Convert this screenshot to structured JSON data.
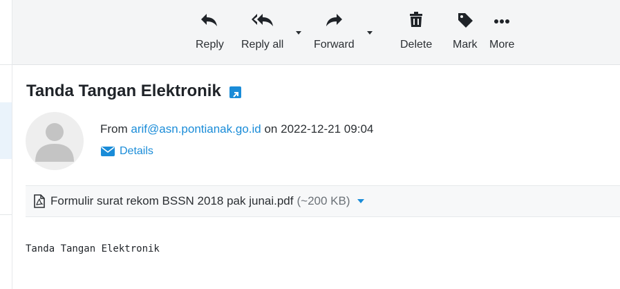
{
  "toolbar": {
    "reply": "Reply",
    "reply_all": "Reply all",
    "forward": "Forward",
    "delete": "Delete",
    "mark": "Mark",
    "more": "More"
  },
  "message": {
    "subject": "Tanda Tangan Elektronik",
    "from_label": "From",
    "from_address": "arif@asn.pontianak.go.id",
    "on_label": "on",
    "date": "2022-12-21 09:04",
    "details_label": "Details",
    "attachment": {
      "filename": "Formulir surat rekom BSSN 2018 pak junai.pdf",
      "size": "(~200 KB)"
    },
    "body": "Tanda Tangan Elektronik"
  },
  "colors": {
    "accent": "#1a8cd8",
    "toolbar_bg": "#f4f5f6"
  },
  "icons": [
    "reply-icon",
    "reply-all-icon",
    "forward-icon",
    "trash-icon",
    "tag-icon",
    "more-icon",
    "external-link-icon",
    "envelope-icon",
    "pdf-file-icon"
  ]
}
